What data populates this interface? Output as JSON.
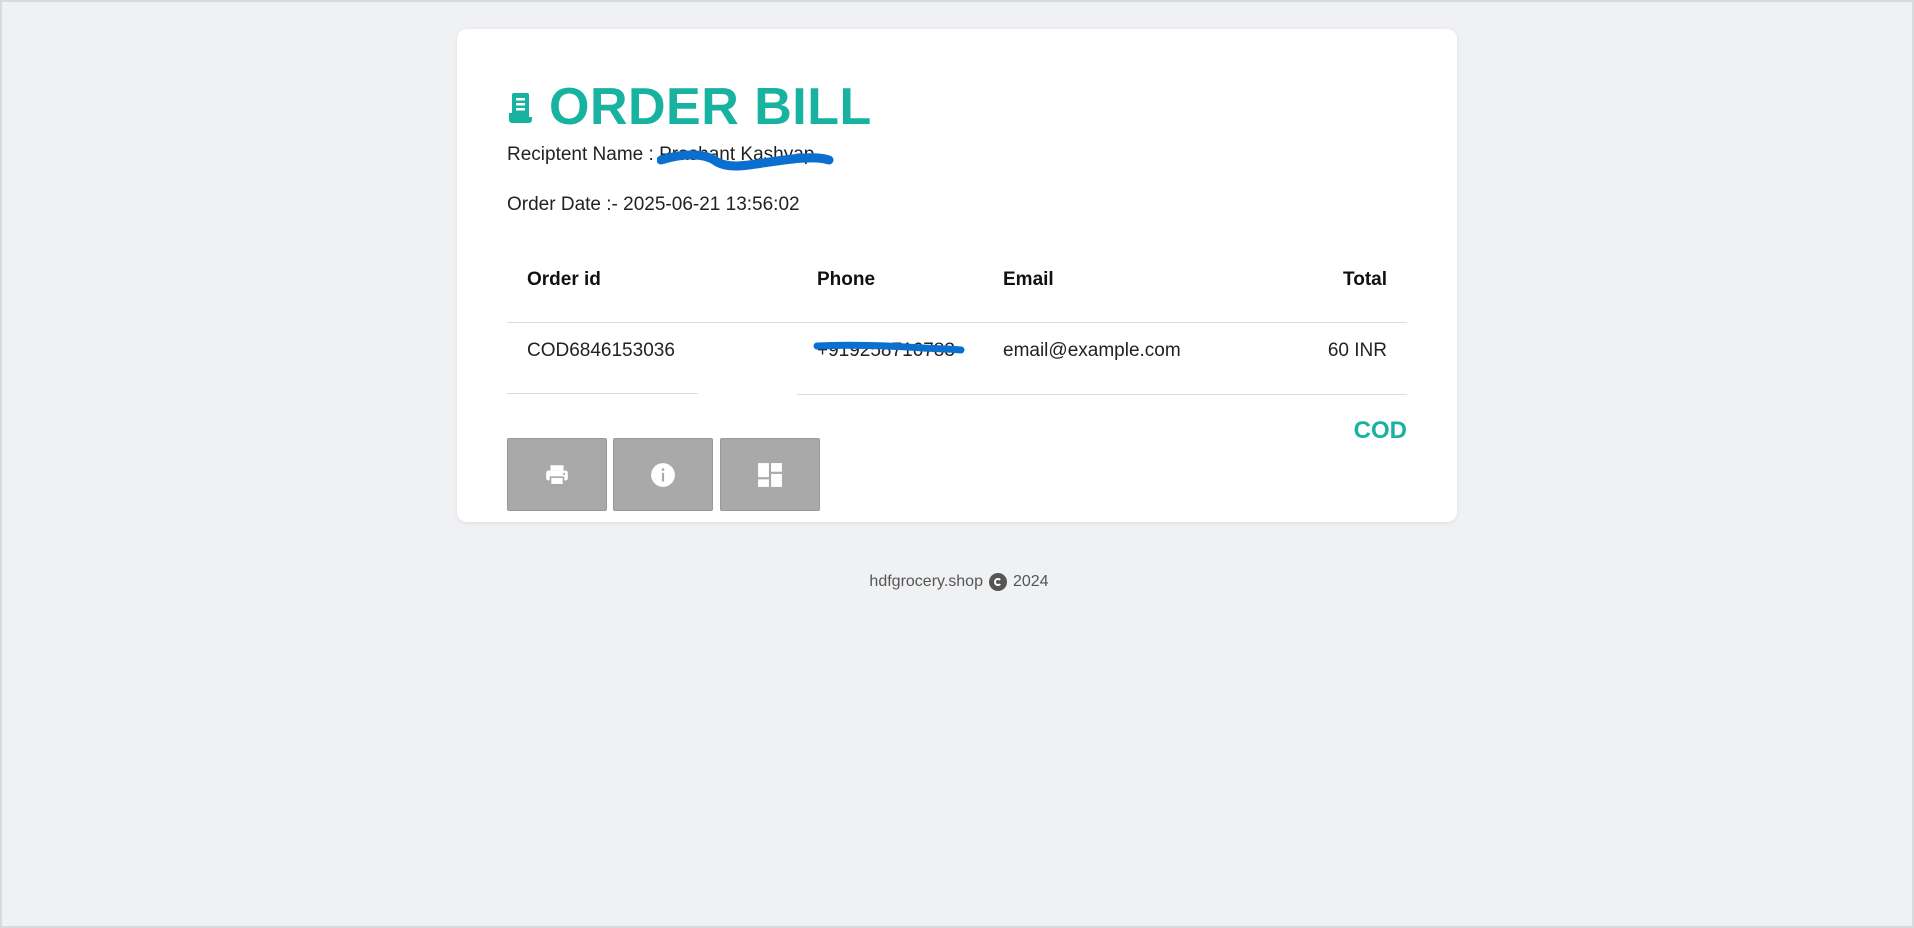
{
  "bill": {
    "title": "ORDER BILL",
    "icon": "receipt-icon",
    "recipient_label": "Reciptent Name :",
    "recipient_value": "Prashant Kashyap",
    "order_date_label": "Order Date :-",
    "order_date_value": "2025-06-21 13:56:02"
  },
  "table": {
    "headers": [
      "Order id",
      "Phone",
      "Email",
      "Total"
    ],
    "row": {
      "order_id": "COD6846153036",
      "phone": "+919258716783",
      "email": "email@example.com",
      "total": "60 INR"
    }
  },
  "payment_method": "COD",
  "actions": [
    {
      "icon": "print-icon"
    },
    {
      "icon": "info-icon"
    },
    {
      "icon": "dashboard-icon"
    }
  ],
  "footer": {
    "site": "hdfgrocery.shop",
    "year": "2024",
    "icon": "copyright-icon"
  },
  "colors": {
    "accent": "#17b3a0",
    "redaction": "#0a6fcf",
    "button": "#a9a9a9",
    "background": "#f0f1f3"
  }
}
